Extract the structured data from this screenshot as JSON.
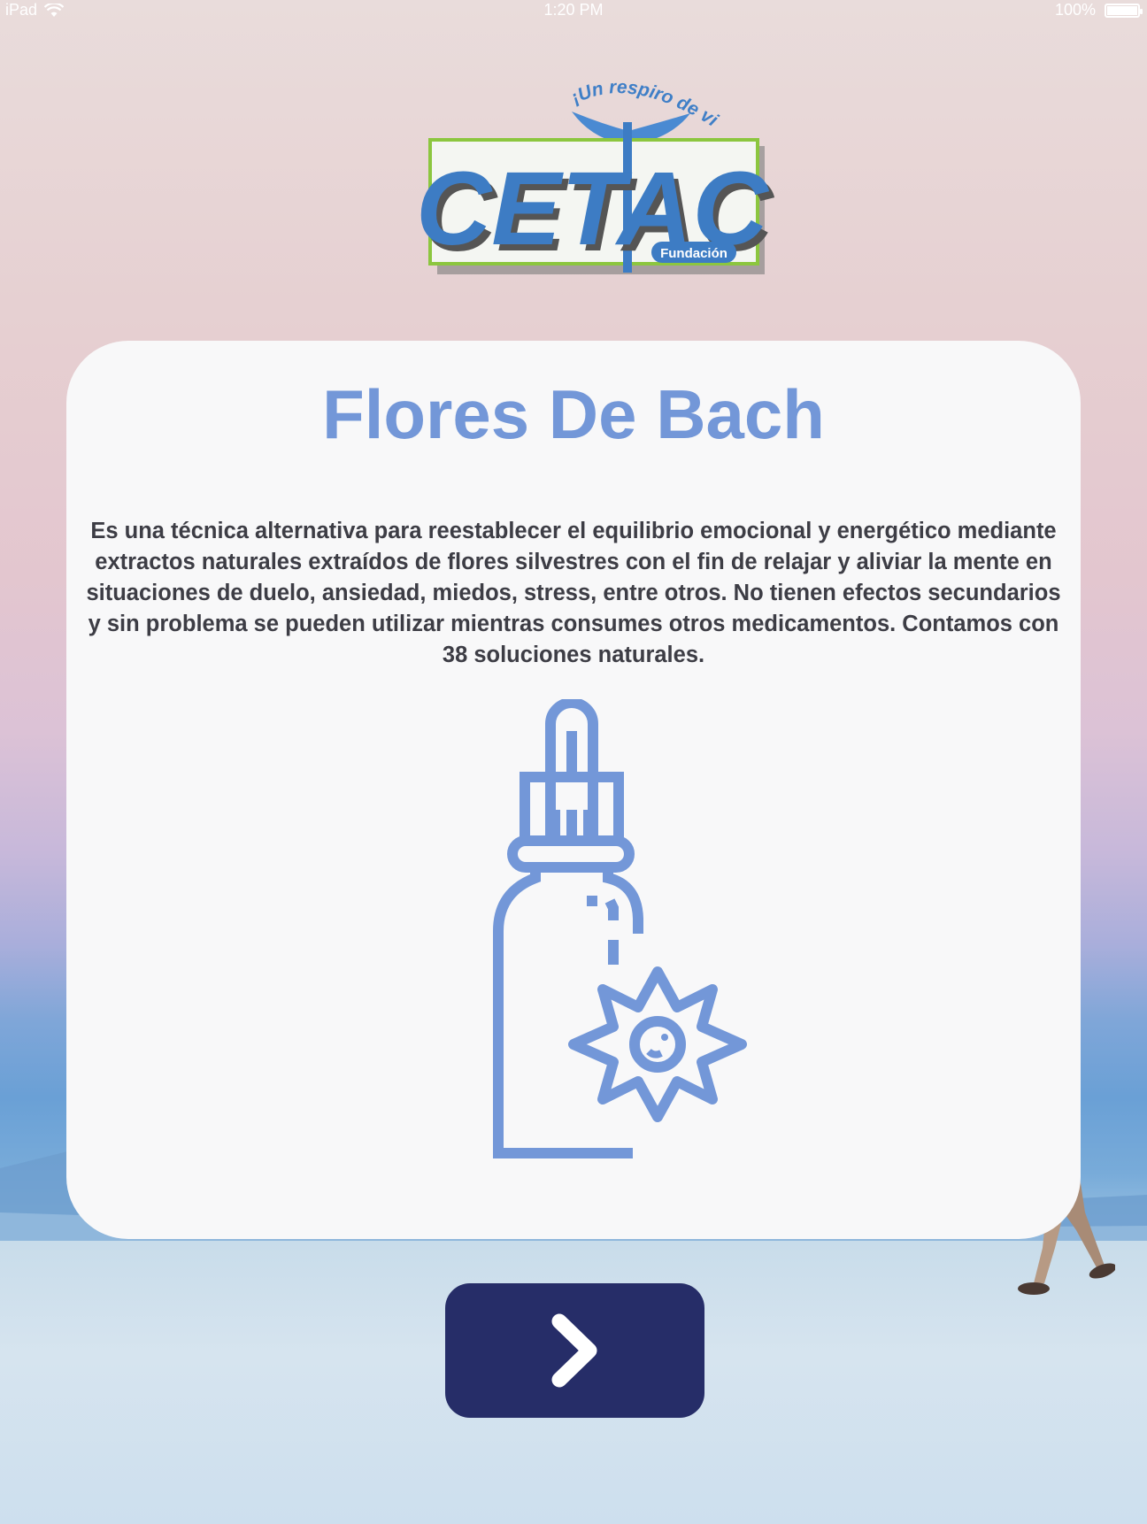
{
  "status_bar": {
    "device": "iPad",
    "time": "1:20 PM",
    "battery": "100%"
  },
  "logo": {
    "name": "CETAC",
    "tagline": "¡Un respiro de vida!",
    "subtitle": "Fundación"
  },
  "card": {
    "title": "Flores De Bach",
    "description": "Es una técnica alternativa para reestablecer el equilibrio emocional y energético mediante extractos naturales extraídos de flores silvestres con el fin de relajar y aliviar la mente en situaciones de duelo, ansiedad, miedos, stress, entre otros. No tienen efectos secundarios y sin problema se pueden utilizar mientras consumes otros medicamentos. Contamos con 38 soluciones naturales.",
    "icon": "dropper-bottle-flower-icon"
  },
  "navigation": {
    "next_icon": "chevron-right-icon"
  },
  "colors": {
    "accent": "#7397d8",
    "button": "#262d68",
    "card": "#f8f8f9",
    "text": "#3d3d45"
  }
}
